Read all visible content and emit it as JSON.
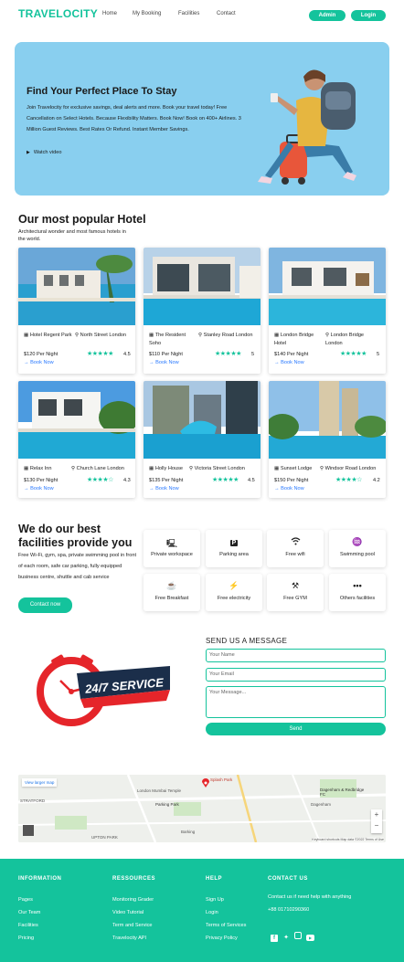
{
  "nav": {
    "logo": "TRAVELOCITY",
    "links": [
      "Home",
      "My Booking",
      "Facilities",
      "Contact"
    ],
    "admin_label": "Admin",
    "login_label": "Login"
  },
  "hero": {
    "title": "Find Your Perfect Place To Stay",
    "description": "Join Travelocity for exclusive savings, deal alerts and more. Book your travel today! Free Cancellation on Select Hotels. Because Flexibility Matters. Book Now! Book on 400+ Airlines. 3 Million Guest Reviews. Best Rates Or Refund. Instant Member Savings.",
    "video_label": "Watch video"
  },
  "popular": {
    "title": "Our most popular Hotel",
    "subtitle": "Architectural wonder and most famous hotels in the world.",
    "book_label": "Book Now",
    "hotels": [
      {
        "name": "Hotel Regent Park",
        "location": "North Street London",
        "price": "$120 Per Night",
        "rating": "4.5",
        "stars": "★★★★★"
      },
      {
        "name": "The Resident Soho",
        "location": "Stanley Road London",
        "price": "$110 Per Night",
        "rating": "5",
        "stars": "★★★★★"
      },
      {
        "name": "London Bridge Hotel",
        "location": "London Bridge London",
        "price": "$140 Per Night",
        "rating": "5",
        "stars": "★★★★★"
      },
      {
        "name": "Relax Inn",
        "location": "Church Lane London",
        "price": "$130 Per Night",
        "rating": "4.3",
        "stars": "★★★★☆"
      },
      {
        "name": "Holly House",
        "location": "Victoria Street London",
        "price": "$135 Per Night",
        "rating": "4.5",
        "stars": "★★★★★"
      },
      {
        "name": "Sunset Lodge",
        "location": "Windsor Road London",
        "price": "$150 Per Night",
        "rating": "4.2",
        "stars": "★★★★☆"
      }
    ]
  },
  "facilities": {
    "title": "We do our best facilities provide you",
    "description": "Free Wi-Fi, gym, spa, private swimming pool in front of each room, safe car parking, fully equipped business centre, shuttle and cab service",
    "contact_label": "Contact now",
    "items": [
      {
        "label": "Private workspace",
        "icon": "🖳"
      },
      {
        "label": "Parking area",
        "icon": "P"
      },
      {
        "label": "Free wifi",
        "icon": "☰"
      },
      {
        "label": "Swimming pool",
        "icon": "♒"
      },
      {
        "label": "Free Breakfast",
        "icon": "☕"
      },
      {
        "label": "Free electricity",
        "icon": "⚡"
      },
      {
        "label": "Free GYM",
        "icon": "⚒"
      },
      {
        "label": "Others facilities",
        "icon": "•••"
      }
    ]
  },
  "message": {
    "title": "SEND US A MESSAGE",
    "name_placeholder": "Your Name",
    "email_placeholder": "Your Email",
    "message_placeholder": "Your Message...",
    "send_label": "Send",
    "service_text": "24/7 SERVICE"
  },
  "map": {
    "larger_map": "View larger map",
    "labels": [
      "Splash Park",
      "Parking Park",
      "London Mumbai Temple",
      "UPTON PARK",
      "STRATFORD",
      "Dagenham & Redbridge FC",
      "Dagenham",
      "Barking"
    ],
    "footer_text": "Keyboard shortcuts  Map data ©2022  Terms of Use"
  },
  "footer": {
    "columns": [
      {
        "heading": "INFORMATION",
        "links": [
          "Pages",
          "Our Team",
          "Facilities",
          "Pricing"
        ]
      },
      {
        "heading": "RESSOURCES",
        "links": [
          "Monitoring Grader",
          "Video Tutorial",
          "Term and Service",
          "Travelocity API"
        ]
      },
      {
        "heading": "HELP",
        "links": [
          "Sign Up",
          "Login",
          "Terms of Services",
          "Privacy Policy"
        ]
      },
      {
        "heading": "CONTACT US",
        "links": [
          "Contact us if need help with anything",
          "+88 01710290360"
        ]
      }
    ]
  },
  "colors": {
    "accent": "#14c39c",
    "hero_bg": "#89cfef",
    "link": "#2979ff"
  }
}
